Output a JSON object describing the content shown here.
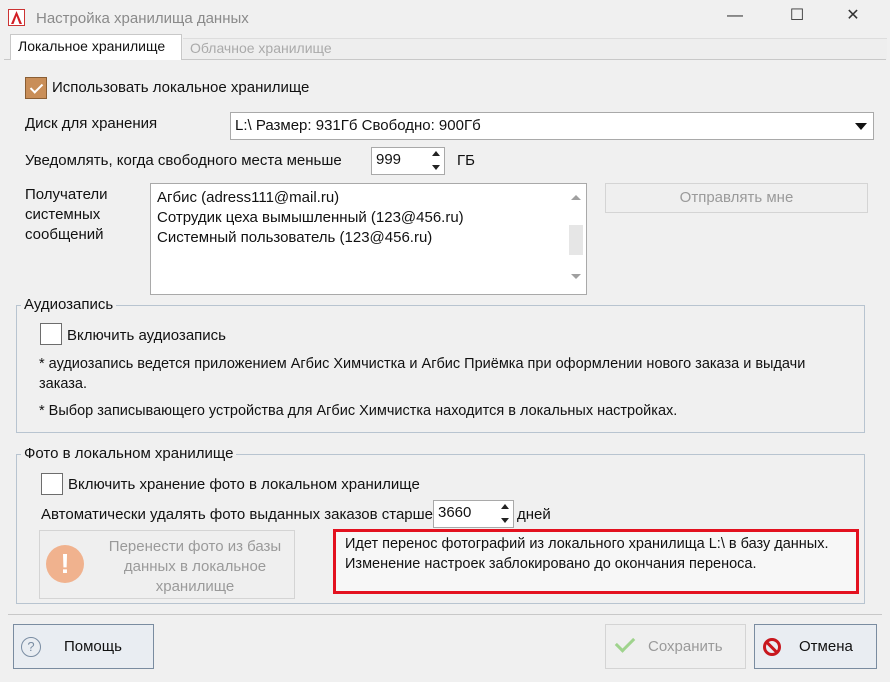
{
  "window": {
    "title": "Настройка хранилища данных",
    "minimize": "—",
    "maximize": "☐",
    "close": "✕"
  },
  "tabs": [
    {
      "label": "Локальное хранилище"
    },
    {
      "label": "Облачное хранилище"
    }
  ],
  "local": {
    "use_local_label": "Использовать локальное хранилище",
    "use_local_checked": true,
    "disk_label": "Диск для хранения",
    "disk_value": "L:\\ Размер: 931Гб Свободно: 900Гб",
    "notify_label": "Уведомлять, когда свободного места меньше",
    "notify_value": "999",
    "notify_unit": "ГБ",
    "recipients_label_1": "Получатели",
    "recipients_label_2": "системных",
    "recipients_label_3": "сообщений",
    "recipients": [
      "Агбис (adress111@mail.ru)",
      "Сотрудик цеха вымышленный (123@456.ru)",
      "Системный пользователь (123@456.ru)"
    ],
    "send_me_button": "Отправлять мне"
  },
  "audio": {
    "group_title": "Аудиозапись",
    "enable_label": "Включить аудиозапись",
    "enable_checked": false,
    "note_1a": "* аудиозапись ведется приложением Агбис Химчистка и Агбис Приёмка при оформлении нового заказа и выдачи",
    "note_1b": "заказа.",
    "note_2": "* Выбор записывающего устройства для Агбис Химчистка находится в локальных настройках."
  },
  "photo": {
    "group_title": "Фото в локальном хранилище",
    "enable_label": "Включить хранение фото в локальном хранилище",
    "enable_checked": false,
    "auto_delete_label": "Автоматически удалять фото выданных заказов старше",
    "auto_delete_value": "3660",
    "auto_delete_unit": "дней",
    "transfer_button_1": "Перенести фото из базы",
    "transfer_button_2": "данных в локальное",
    "transfer_button_3": "хранилище",
    "transfer_icon": "!",
    "message_1": "Идет перенос фотографий из локального хранилища L:\\ в базу данных.",
    "message_2": "Изменение настроек заблокировано  до окончания переноса."
  },
  "footer": {
    "help_button": "Помощь",
    "help_icon": "?",
    "save_button": "Сохранить",
    "cancel_button": "Отмена"
  },
  "colors": {
    "highlight_border": "#e3111f",
    "checkbox_checked": "#c98e58",
    "cancel_icon": "#c8171e",
    "save_icon": "#9fd38d"
  }
}
